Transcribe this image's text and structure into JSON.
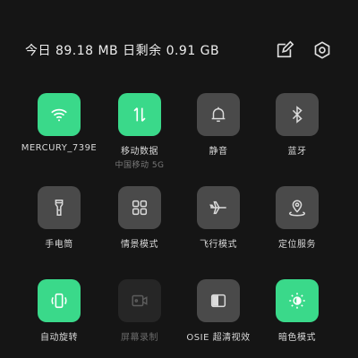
{
  "status": {
    "usage_text": "今日 89.18 MB 日剩余 0.91 GB"
  },
  "header": {
    "edit_icon": "edit-icon",
    "settings_icon": "settings-gear-icon"
  },
  "tiles": [
    {
      "label": "MERCURY_739E",
      "icon": "wifi-icon",
      "state": "on"
    },
    {
      "label": "移动数据",
      "sub": "中国移动 5G",
      "icon": "mobile-data-icon",
      "state": "on"
    },
    {
      "label": "静音",
      "icon": "bell-icon",
      "state": "off"
    },
    {
      "label": "蓝牙",
      "icon": "bluetooth-icon",
      "state": "off"
    },
    {
      "label": "手电筒",
      "icon": "flashlight-icon",
      "state": "off"
    },
    {
      "label": "情景模式",
      "icon": "scene-mode-icon",
      "state": "off"
    },
    {
      "label": "飞行模式",
      "icon": "airplane-icon",
      "state": "off"
    },
    {
      "label": "定位服务",
      "icon": "location-icon",
      "state": "off"
    },
    {
      "label": "自动旋转",
      "icon": "auto-rotate-icon",
      "state": "on"
    },
    {
      "label": "屏幕录制",
      "icon": "screen-record-icon",
      "state": "disabled"
    },
    {
      "label": "OSIE 超清视效",
      "icon": "osie-icon",
      "state": "off"
    },
    {
      "label": "暗色模式",
      "icon": "dark-mode-icon",
      "state": "on"
    }
  ],
  "colors": {
    "on": "#3ad98a",
    "off": "#4a4a4a",
    "disabled": "#262626",
    "background": "#151515"
  }
}
